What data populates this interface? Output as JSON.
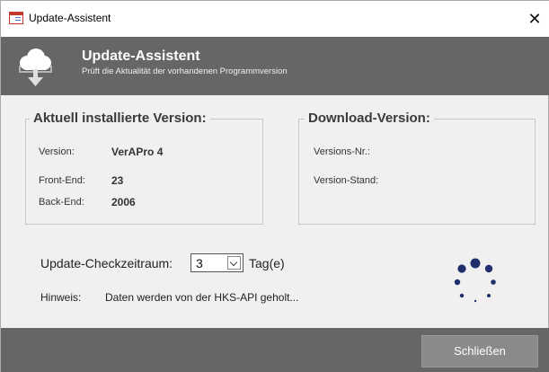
{
  "window": {
    "title": "Update-Assistent",
    "close_glyph": "✕"
  },
  "header": {
    "title": "Update-Assistent",
    "subtitle": "Prüft die Aktualität der vorhandenen Programmversion",
    "icon": "cloud-download-icon"
  },
  "installed": {
    "legend": "Aktuell installierte Version:",
    "rows": [
      {
        "label": "Version:",
        "value": "VerAPro 4"
      },
      {
        "label": "Front-End:",
        "value": "23"
      },
      {
        "label": "Back-End:",
        "value": "2006"
      }
    ]
  },
  "download": {
    "legend": "Download-Version:",
    "rows": [
      {
        "label": "Versions-Nr.:",
        "value": ""
      },
      {
        "label": "Version-Stand:",
        "value": ""
      }
    ]
  },
  "check": {
    "label": "Update-Checkzeitraum:",
    "value": "3",
    "unit": "Tag(e)"
  },
  "hint": {
    "label": "Hinweis:",
    "text": "Daten werden von der HKS-API geholt..."
  },
  "footer": {
    "close_label": "Schließen"
  },
  "colors": {
    "header_bg": "#666666",
    "footer_bg": "#666666",
    "spinner": "#1f2f6b"
  }
}
